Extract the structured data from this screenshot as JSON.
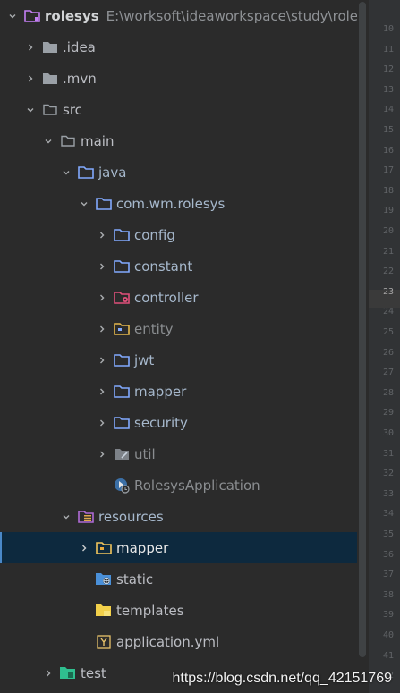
{
  "project": {
    "name": "rolesys",
    "path": "E:\\worksoft\\ideaworkspace\\study\\rolesys"
  },
  "tree": [
    {
      "label": "rolesys",
      "expanded": true,
      "icon": "module-folder-icon"
    },
    {
      "label": ".idea",
      "expanded": false,
      "icon": "folder-icon"
    },
    {
      "label": ".mvn",
      "expanded": false,
      "icon": "folder-icon"
    },
    {
      "label": "src",
      "expanded": true,
      "icon": "folder-icon"
    },
    {
      "label": "main",
      "expanded": true,
      "icon": "folder-icon"
    },
    {
      "label": "java",
      "expanded": true,
      "icon": "source-root-icon"
    },
    {
      "label": "com.wm.rolesys",
      "expanded": true,
      "icon": "package-icon"
    },
    {
      "label": "config",
      "expanded": false,
      "icon": "package-icon"
    },
    {
      "label": "constant",
      "expanded": false,
      "icon": "package-icon"
    },
    {
      "label": "controller",
      "expanded": false,
      "icon": "controller-package-icon"
    },
    {
      "label": "entity",
      "expanded": false,
      "icon": "entity-package-icon"
    },
    {
      "label": "jwt",
      "expanded": false,
      "icon": "package-icon"
    },
    {
      "label": "mapper",
      "expanded": false,
      "icon": "package-icon"
    },
    {
      "label": "security",
      "expanded": false,
      "icon": "package-icon"
    },
    {
      "label": "util",
      "expanded": false,
      "icon": "util-package-icon"
    },
    {
      "label": "RolesysApplication",
      "icon": "spring-boot-class-icon"
    },
    {
      "label": "resources",
      "expanded": true,
      "icon": "resources-root-icon"
    },
    {
      "label": "mapper",
      "expanded": false,
      "selected": true,
      "icon": "mapper-folder-icon"
    },
    {
      "label": "static",
      "icon": "web-folder-icon"
    },
    {
      "label": "templates",
      "icon": "templates-folder-icon"
    },
    {
      "label": "application.yml",
      "icon": "yaml-file-icon"
    },
    {
      "label": "test",
      "expanded": false,
      "icon": "test-root-icon"
    }
  ],
  "gutter": {
    "line_numbers": [
      "10",
      "11",
      "12",
      "13",
      "14",
      "15",
      "16",
      "17",
      "18",
      "19",
      "20",
      "21",
      "22",
      "23",
      "24",
      "25",
      "26",
      "27",
      "28",
      "29",
      "30",
      "31",
      "32",
      "33",
      "34",
      "35",
      "36",
      "37",
      "38",
      "39",
      "40",
      "41",
      "42"
    ],
    "current_line": "23"
  },
  "watermark": "https://blog.csdn.net/qq_42151769",
  "colors": {
    "background": "#2b2b2b",
    "selection": "#0d293e",
    "folder_blue": "#82aaff",
    "folder_gray": "#9aa0a6",
    "module_purple": "#c47ff5",
    "resource_yellow": "#f2c55c"
  }
}
